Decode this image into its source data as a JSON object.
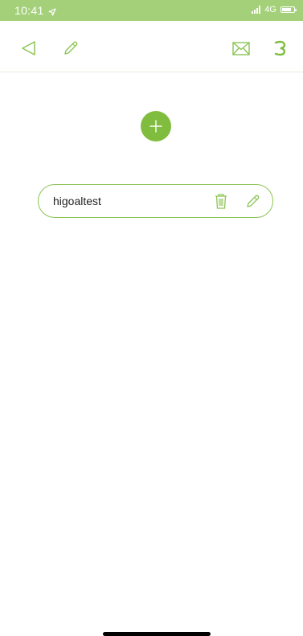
{
  "status_bar": {
    "time": "10:41",
    "network": "4G",
    "battery_level": 0.8
  },
  "nav": {
    "back_icon": "back-triangle-icon",
    "edit_icon": "pencil-icon",
    "mail_icon": "envelope-icon",
    "menu_icon": "reverse-c-icon"
  },
  "list": {
    "items": [
      {
        "label": "higoaltest",
        "delete_icon": "trash-icon",
        "edit_icon": "pencil-icon"
      }
    ]
  },
  "colors": {
    "accent": "#80bd3f",
    "status_bar": "#a4d07a",
    "row_border": "#8cc455"
  }
}
